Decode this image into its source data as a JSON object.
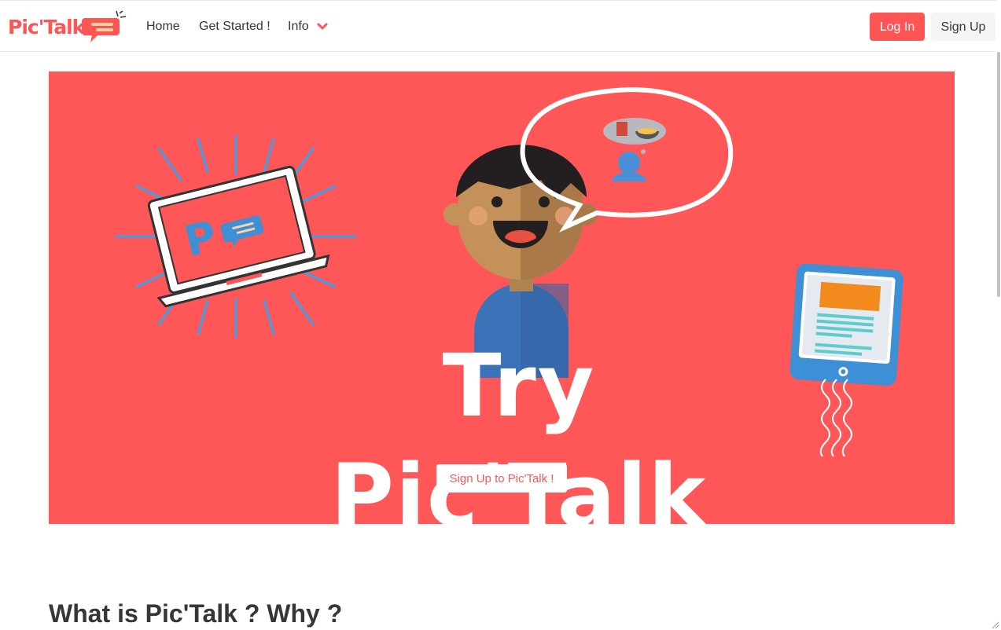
{
  "brand": {
    "name": "Pic'Talk",
    "logo_icon": "speech-bubble-icon",
    "accent": "#ff5555"
  },
  "nav": {
    "home": "Home",
    "get_started": "Get Started !",
    "info": "Info",
    "login": "Log In",
    "signup": "Sign Up"
  },
  "hero": {
    "title": "Try Pic'Talk",
    "cta": "Sign Up to Pic'Talk !",
    "background": "#ff5757",
    "illustrations": [
      "laptop-icon",
      "person-avatar",
      "thought-bubble-icon",
      "tablet-icon"
    ]
  },
  "section": {
    "title": "What is Pic'Talk ? Why ?"
  }
}
